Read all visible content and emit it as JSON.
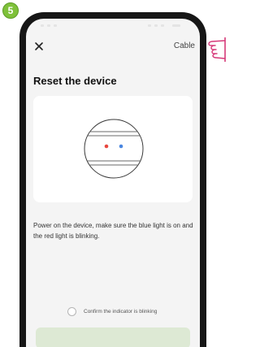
{
  "step_badge": "5",
  "colors": {
    "accent_green": "#7fc13a",
    "hand_pink": "#d63a7a",
    "button_disabled": "#dde9d4"
  },
  "navbar": {
    "close_icon": "close-icon",
    "right_link": "Cable"
  },
  "title": "Reset the device",
  "illustration": {
    "red_light": "#e8473f",
    "blue_light": "#4a86e0"
  },
  "instruction": "Power on the device, make sure the blue light is on and the red light is blinking.",
  "confirm": {
    "label": "Confirm the indicator is blinking",
    "checked": false
  },
  "next_button": {
    "label": "",
    "enabled": false
  },
  "icons": {
    "pointer": "pointing-hand-icon"
  }
}
